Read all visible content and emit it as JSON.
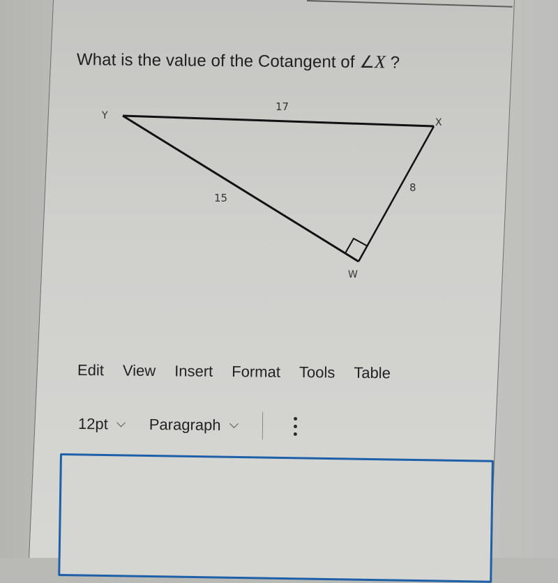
{
  "question": {
    "text": "What is the value of the Cotangent of ",
    "angle_symbol": "∠",
    "angle_var": "X",
    "suffix": " ?"
  },
  "diagram": {
    "vertices": {
      "Y": "Y",
      "X": "X",
      "W": "W"
    },
    "sides": {
      "YX": "17",
      "YW": "15",
      "WX": "8"
    },
    "right_angle_at": "W"
  },
  "editor": {
    "menu": [
      "Edit",
      "View",
      "Insert",
      "Format",
      "Tools",
      "Table"
    ],
    "font_size": "12pt",
    "block_format": "Paragraph",
    "more_icon": "vertical-ellipsis-icon",
    "chevron_icon": "chevron-down-icon",
    "content": "",
    "border_color": "#1d5fa8"
  }
}
